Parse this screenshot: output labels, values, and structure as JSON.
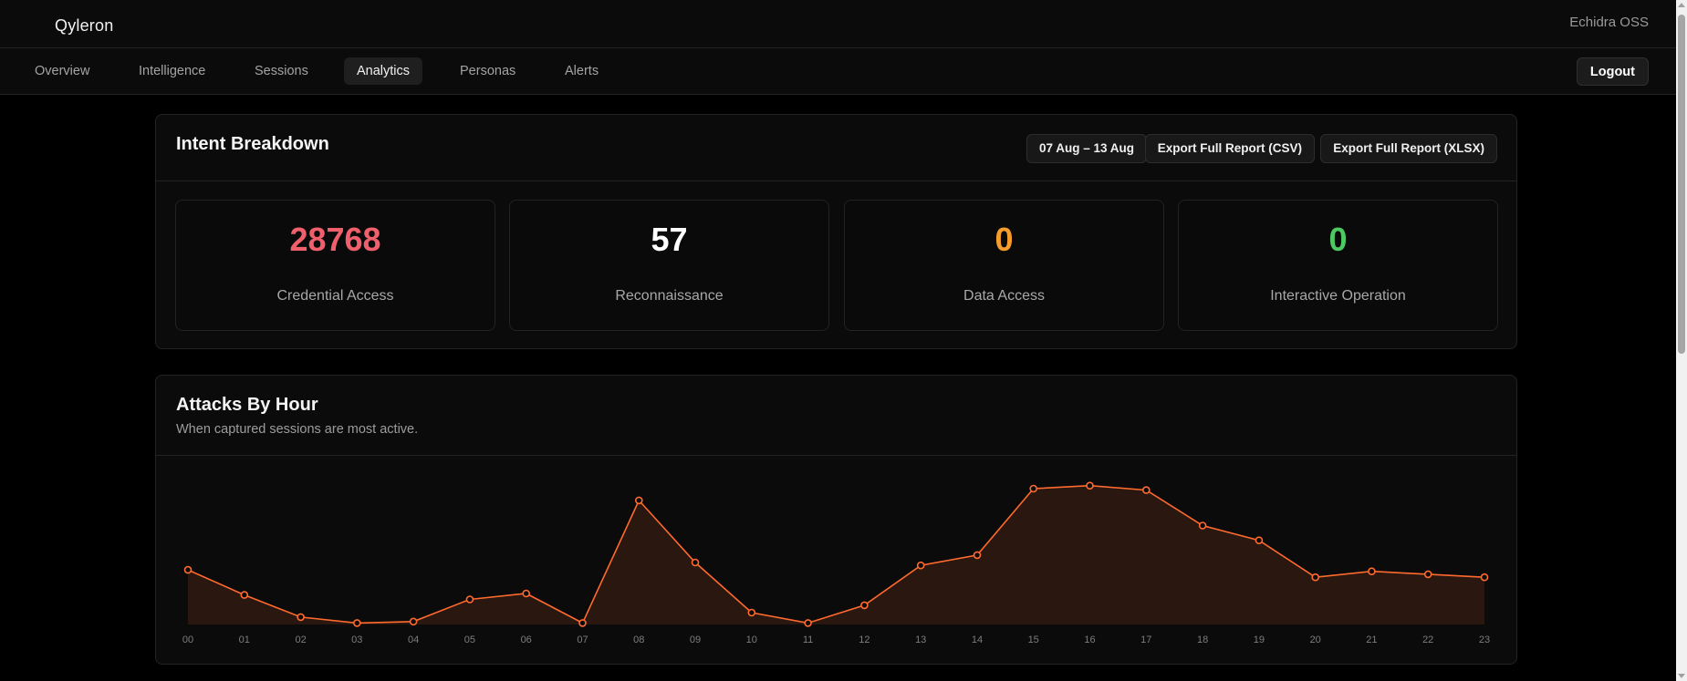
{
  "app": {
    "brand": "Qyleron",
    "org": "Echidra OSS"
  },
  "nav": {
    "tabs": [
      {
        "label": "Overview",
        "active": false
      },
      {
        "label": "Intelligence",
        "active": false
      },
      {
        "label": "Sessions",
        "active": false
      },
      {
        "label": "Analytics",
        "active": true
      },
      {
        "label": "Personas",
        "active": false
      },
      {
        "label": "Alerts",
        "active": false
      }
    ],
    "logout_label": "Logout"
  },
  "intent": {
    "title": "Intent Breakdown",
    "date_range": "07 Aug – 13 Aug",
    "export_csv": "Export Full Report (CSV)",
    "export_xlsx": "Export Full Report (XLSX)",
    "stats": [
      {
        "value": "28768",
        "label": "Credential Access",
        "color": "#f0606c"
      },
      {
        "value": "57",
        "label": "Reconnaissance",
        "color": "#ffffff"
      },
      {
        "value": "0",
        "label": "Data Access",
        "color": "#f59c2a"
      },
      {
        "value": "0",
        "label": "Interactive Operation",
        "color": "#4cc960"
      }
    ]
  },
  "attacks": {
    "title": "Attacks By Hour",
    "subtitle": "When captured sessions are most active."
  },
  "colors": {
    "accent": "#ff6a2e",
    "background": "#000000",
    "card": "#0b0b0b",
    "border": "#232323"
  },
  "chart_data": {
    "type": "area",
    "x": [
      "00",
      "01",
      "02",
      "03",
      "04",
      "05",
      "06",
      "07",
      "08",
      "09",
      "10",
      "11",
      "12",
      "13",
      "14",
      "15",
      "16",
      "17",
      "18",
      "19",
      "20",
      "21",
      "22",
      "23"
    ],
    "values": [
      37,
      20,
      5,
      1,
      2,
      17,
      21,
      1,
      84,
      42,
      8,
      1,
      13,
      40,
      47,
      92,
      94,
      91,
      67,
      57,
      32,
      36,
      34,
      32
    ],
    "ylim": [
      0,
      100
    ],
    "title": "",
    "xlabel": "",
    "ylabel": "",
    "grid": false,
    "legend": "none",
    "color": "#ff6a2e"
  }
}
